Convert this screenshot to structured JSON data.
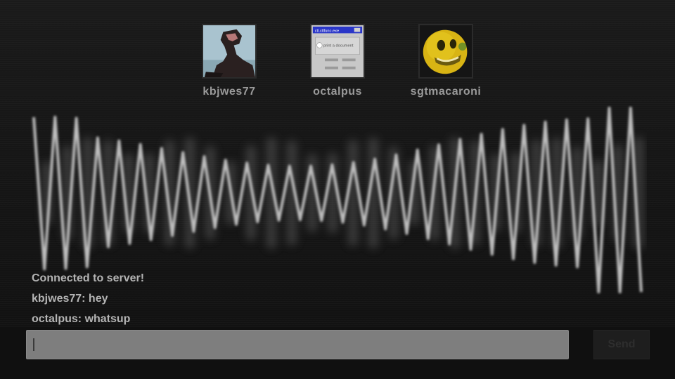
{
  "users": [
    {
      "name": "kbjwes77",
      "avatar": "person-photo"
    },
    {
      "name": "octalpus",
      "avatar": "dialog-window-screenshot",
      "window_title": "ctl.ctlfunc.exe",
      "dialog_text": "print a document"
    },
    {
      "name": "sgtmacaroni",
      "avatar": "smiley-face"
    }
  ],
  "chat": {
    "messages": [
      "Connected to server!",
      "kbjwes77: hey",
      "octalpus: whatsup"
    ]
  },
  "composer": {
    "input_value": "",
    "input_placeholder": "",
    "send_label": "Send"
  },
  "colors": {
    "background": "#141414",
    "wave": "#bdbdbd",
    "text": "#b4b4b4",
    "input": "#7e7e7e"
  }
}
